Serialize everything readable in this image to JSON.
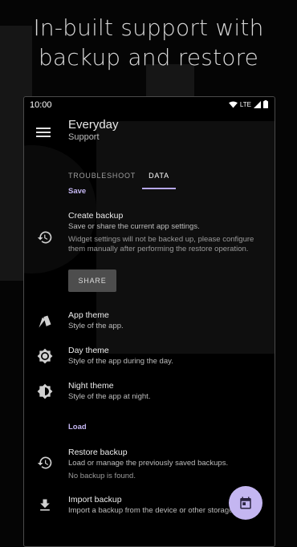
{
  "promo": {
    "line1": "In-built support with",
    "line2": "backup and restore"
  },
  "status_bar": {
    "time": "10:00",
    "network": "LTE",
    "icons": [
      "wifi-icon",
      "signal-icon",
      "battery-icon"
    ]
  },
  "app_bar": {
    "menu_icon": "menu-icon",
    "title": "Everyday",
    "subtitle": "Support"
  },
  "tabs": [
    {
      "label": "TROUBLESHOOT",
      "active": false
    },
    {
      "label": "DATA",
      "active": true
    }
  ],
  "sections": {
    "save": "Save",
    "load": "Load"
  },
  "items": {
    "create_backup": {
      "icon": "backup-restore-icon",
      "title": "Create backup",
      "subtitle": "Save or share the current app settings.",
      "description": "Widget settings will not be backed up, please configure them manually after performing the restore operation.",
      "button": "SHARE"
    },
    "app_theme": {
      "icon": "palette-icon",
      "title": "App theme",
      "subtitle": "Style of the app."
    },
    "day_theme": {
      "icon": "brightness-icon",
      "title": "Day theme",
      "subtitle": "Style of the app during the day."
    },
    "night_theme": {
      "icon": "brightness-auto-icon",
      "title": "Night theme",
      "subtitle": "Style of the app at night."
    },
    "restore_backup": {
      "icon": "restore-icon",
      "title": "Restore backup",
      "subtitle": "Load or manage the previously saved backups.",
      "description": "No backup is found."
    },
    "import_backup": {
      "icon": "download-icon",
      "title": "Import backup",
      "subtitle": "Import a backup from the device or other storage."
    }
  },
  "fab": {
    "icon": "calendar-icon"
  },
  "colors": {
    "accent": "#c4b6f1",
    "background": "#000000",
    "button": "#4d4d4d"
  }
}
